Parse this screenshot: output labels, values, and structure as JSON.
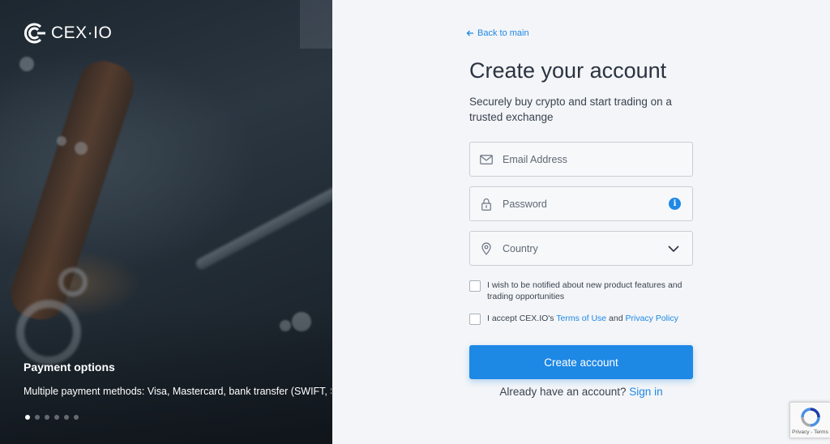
{
  "brand": {
    "name": "CEX·IO"
  },
  "hero": {
    "title": "Payment options",
    "text": "Multiple payment methods: Visa, Mastercard, bank transfer (SWIFT, SEPA, A",
    "slide_count": 6,
    "active_slide": 1
  },
  "form": {
    "back_label": "Back to main",
    "title": "Create your account",
    "subtitle": "Securely buy crypto and start trading on a trusted exchange",
    "email_placeholder": "Email Address",
    "password_placeholder": "Password",
    "country_placeholder": "Country",
    "notify_label": "I wish to be notified about new product features and trading opportunities",
    "accept_prefix": "I accept CEX.IO's ",
    "terms_label": "Terms of Use",
    "accept_and": " and ",
    "privacy_label": "Privacy Policy",
    "submit_label": "Create account",
    "signin_prompt": "Already have an account?",
    "signin_label": "Sign in"
  },
  "recaptcha": {
    "label": "Privacy - Terms"
  },
  "colors": {
    "accent": "#1e88e5",
    "title": "#2b3341",
    "background": "#f3f5f8"
  },
  "icons": [
    "cexio-logo-icon",
    "arrow-left-icon",
    "envelope-icon",
    "lock-icon",
    "info-icon",
    "map-pin-icon",
    "chevron-down-icon",
    "recaptcha-icon"
  ]
}
